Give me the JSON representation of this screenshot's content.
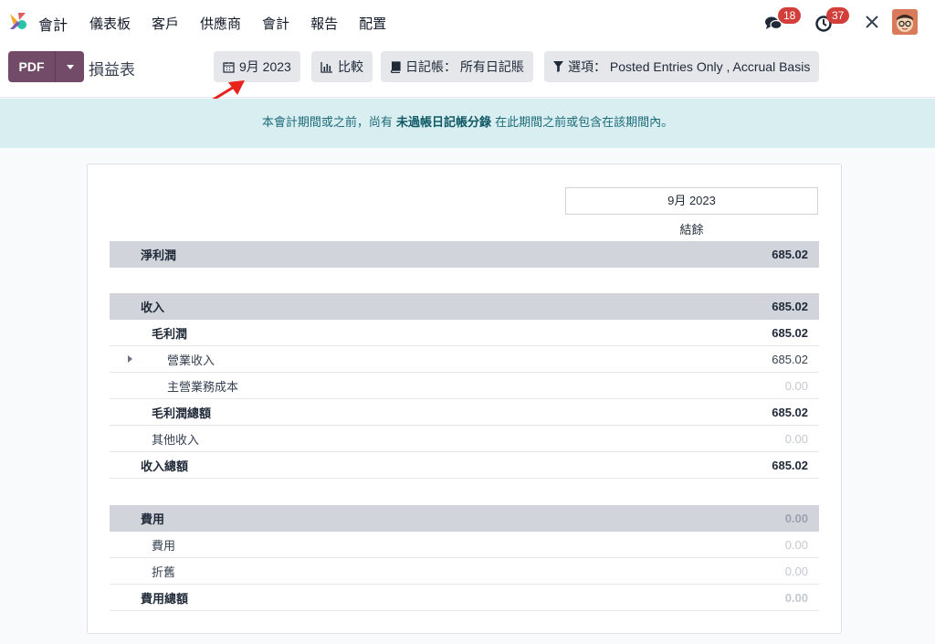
{
  "app": {
    "name": "會計"
  },
  "menu": [
    "儀表板",
    "客戶",
    "供應商",
    "會計",
    "報告",
    "配置"
  ],
  "systray": {
    "messages_count": "18",
    "activities_count": "37"
  },
  "toolbar": {
    "pdf_label": "PDF",
    "title": "損益表",
    "date_filter": "9月 2023",
    "compare_label": "比較",
    "journal_filter": "日記帳： 所有日記賬",
    "options_filter": "選項： Posted Entries Only , Accrual Basis"
  },
  "alert": {
    "prefix": "本會計期間或之前，尚有 ",
    "link": "未過帳日記帳分錄",
    "suffix": " 在此期間之前或包含在該期間內。"
  },
  "report": {
    "period_header": "9月 2023",
    "balance_header": "結餘",
    "rows": [
      {
        "label": "淨利潤",
        "value": "685.02"
      },
      {
        "label": "收入",
        "value": "685.02"
      },
      {
        "label": "毛利潤",
        "value": "685.02"
      },
      {
        "label": "營業收入",
        "value": "685.02"
      },
      {
        "label": "主營業務成本",
        "value": "0.00"
      },
      {
        "label": "毛利潤總額",
        "value": "685.02"
      },
      {
        "label": "其他收入",
        "value": "0.00"
      },
      {
        "label": "收入總額",
        "value": "685.02"
      },
      {
        "label": "費用",
        "value": "0.00"
      },
      {
        "label": "費用",
        "value": "0.00"
      },
      {
        "label": "折舊",
        "value": "0.00"
      },
      {
        "label": "費用總額",
        "value": "0.00"
      }
    ]
  },
  "colors": {
    "brand": "#714b67",
    "alert_bg": "#d9eef1",
    "badge": "#d23f3a",
    "annotation_arrow": "#e8231b"
  }
}
